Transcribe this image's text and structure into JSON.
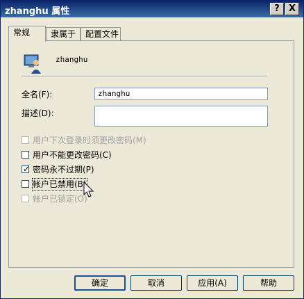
{
  "window": {
    "title": "zhanghu 属性",
    "help_btn": "?",
    "close_btn": "X"
  },
  "tabs": [
    "常规",
    "隶属于",
    "配置文件"
  ],
  "user": {
    "name": "zhanghu",
    "icon": "user-icon"
  },
  "fields": {
    "fullname_label": "全名(F):",
    "fullname_value": "zhanghu",
    "desc_label": "描述(D):",
    "desc_value": ""
  },
  "checkboxes": [
    {
      "label": "用户下次登录时须更改密码(M)",
      "checked": false,
      "disabled": true
    },
    {
      "label": "用户不能更改密码(C)",
      "checked": false,
      "disabled": false
    },
    {
      "label": "密码永不过期(P)",
      "checked": true,
      "disabled": false
    },
    {
      "label": "帐户已禁用(B)",
      "checked": false,
      "disabled": false
    },
    {
      "label": "帐户已锁定(O)",
      "checked": false,
      "disabled": true
    }
  ],
  "buttons": {
    "ok": "确定",
    "cancel": "取消",
    "apply": "应用(A)",
    "help": "帮助"
  },
  "colors": {
    "titlebar": "#0a246a",
    "face": "#ece9d8"
  }
}
